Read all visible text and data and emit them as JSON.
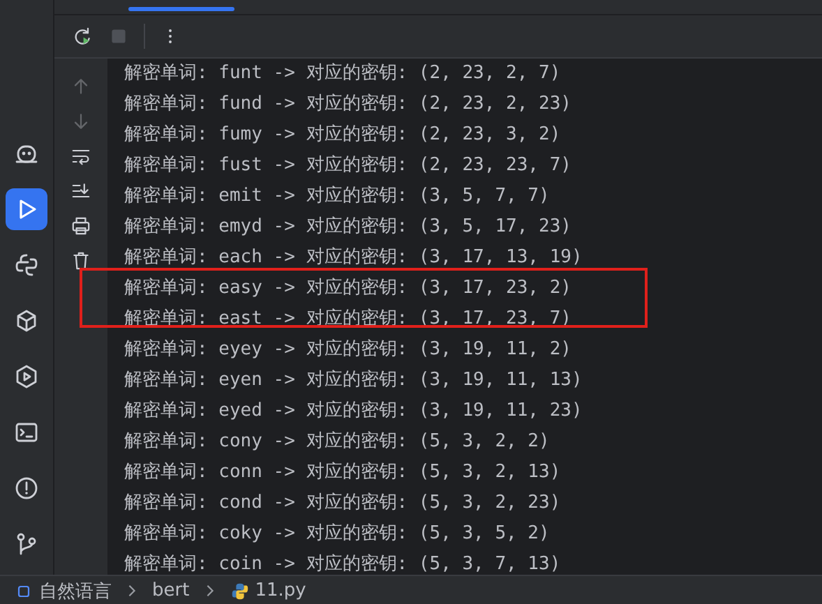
{
  "toolbar": {
    "buttons": [
      {
        "kind": "rerun"
      },
      {
        "kind": "stop",
        "disabled": true
      },
      {
        "kind": "more"
      }
    ]
  },
  "tool_strip": {
    "items": [
      {
        "kind": "ml",
        "selected": false
      },
      {
        "kind": "run",
        "selected": true
      },
      {
        "kind": "python",
        "selected": false
      },
      {
        "kind": "packages",
        "selected": false
      },
      {
        "kind": "services",
        "selected": false
      },
      {
        "kind": "terminal",
        "selected": false
      },
      {
        "kind": "problems",
        "selected": false
      },
      {
        "kind": "git",
        "selected": false
      }
    ]
  },
  "console_actions": [
    {
      "kind": "up",
      "disabled": true
    },
    {
      "kind": "down",
      "disabled": true
    },
    {
      "kind": "wrap",
      "disabled": false
    },
    {
      "kind": "scroll-end",
      "disabled": false
    },
    {
      "kind": "print",
      "disabled": false
    },
    {
      "kind": "trash",
      "disabled": false
    }
  ],
  "console": {
    "lines": [
      {
        "text": "解密单词: funt -> 对应的密钥: (2, 23, 2, 7)",
        "highlighted": false
      },
      {
        "text": "解密单词: fund -> 对应的密钥: (2, 23, 2, 23)",
        "highlighted": false
      },
      {
        "text": "解密单词: fumy -> 对应的密钥: (2, 23, 3, 2)",
        "highlighted": false
      },
      {
        "text": "解密单词: fust -> 对应的密钥: (2, 23, 23, 7)",
        "highlighted": false
      },
      {
        "text": "解密单词: emit -> 对应的密钥: (3, 5, 7, 7)",
        "highlighted": false
      },
      {
        "text": "解密单词: emyd -> 对应的密钥: (3, 5, 17, 23)",
        "highlighted": false
      },
      {
        "text": "解密单词: each -> 对应的密钥: (3, 17, 13, 19)",
        "highlighted": false
      },
      {
        "text": "解密单词: easy -> 对应的密钥: (3, 17, 23, 2)",
        "highlighted": true
      },
      {
        "text": "解密单词: east -> 对应的密钥: (3, 17, 23, 7)",
        "highlighted": true
      },
      {
        "text": "解密单词: eyey -> 对应的密钥: (3, 19, 11, 2)",
        "highlighted": false
      },
      {
        "text": "解密单词: eyen -> 对应的密钥: (3, 19, 11, 13)",
        "highlighted": false
      },
      {
        "text": "解密单词: eyed -> 对应的密钥: (3, 19, 11, 23)",
        "highlighted": false
      },
      {
        "text": "解密单词: cony -> 对应的密钥: (5, 3, 2, 2)",
        "highlighted": false
      },
      {
        "text": "解密单词: conn -> 对应的密钥: (5, 3, 2, 13)",
        "highlighted": false
      },
      {
        "text": "解密单词: cond -> 对应的密钥: (5, 3, 2, 23)",
        "highlighted": false
      },
      {
        "text": "解密单词: coky -> 对应的密钥: (5, 3, 5, 2)",
        "highlighted": false
      },
      {
        "text": "解密单词: coin -> 对应的密钥: (5, 3, 7, 13)",
        "highlighted": false
      }
    ]
  },
  "status_bar": {
    "breadcrumbs": [
      {
        "kind": "module",
        "label": "自然语言"
      },
      {
        "kind": "folder",
        "label": "bert"
      },
      {
        "kind": "python-file",
        "label": "11.py"
      }
    ]
  }
}
